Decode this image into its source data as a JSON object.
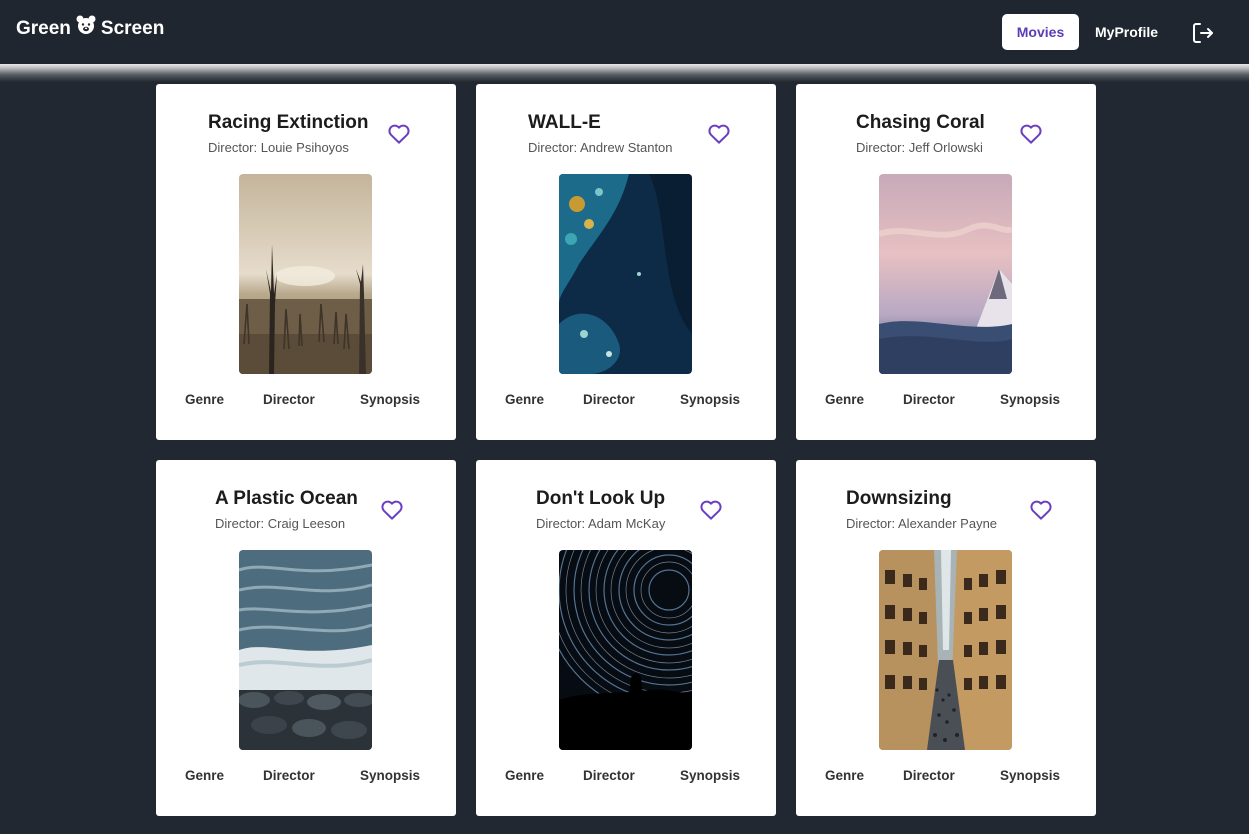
{
  "nav": {
    "brand_left": "Green",
    "brand_right": "Screen",
    "movies_label": "Movies",
    "profile_label": "MyProfile",
    "logout_icon": "logout-icon"
  },
  "colors": {
    "background": "#222831",
    "accent": "#5b3bb7",
    "card": "#ffffff"
  },
  "movies": [
    {
      "title": "Racing Extinction",
      "director": "Director: Louie Psihoyos",
      "poster": "misty-dead-trees"
    },
    {
      "title": "WALL-E",
      "director": "Director: Andrew Stanton",
      "poster": "earth-from-space"
    },
    {
      "title": "Chasing Coral",
      "director": "Director: Jeff Orlowski",
      "poster": "pink-sky-mountain"
    },
    {
      "title": "A Plastic Ocean",
      "director": "Director: Craig Leeson",
      "poster": "ocean-waves-rocks"
    },
    {
      "title": "Don't Look Up",
      "director": "Director: Adam McKay",
      "poster": "star-trails"
    },
    {
      "title": "Downsizing",
      "director": "Director: Alexander Payne",
      "poster": "city-street"
    }
  ],
  "card_actions": {
    "genre": "Genre",
    "director": "Director",
    "synopsis": "Synopsis"
  }
}
